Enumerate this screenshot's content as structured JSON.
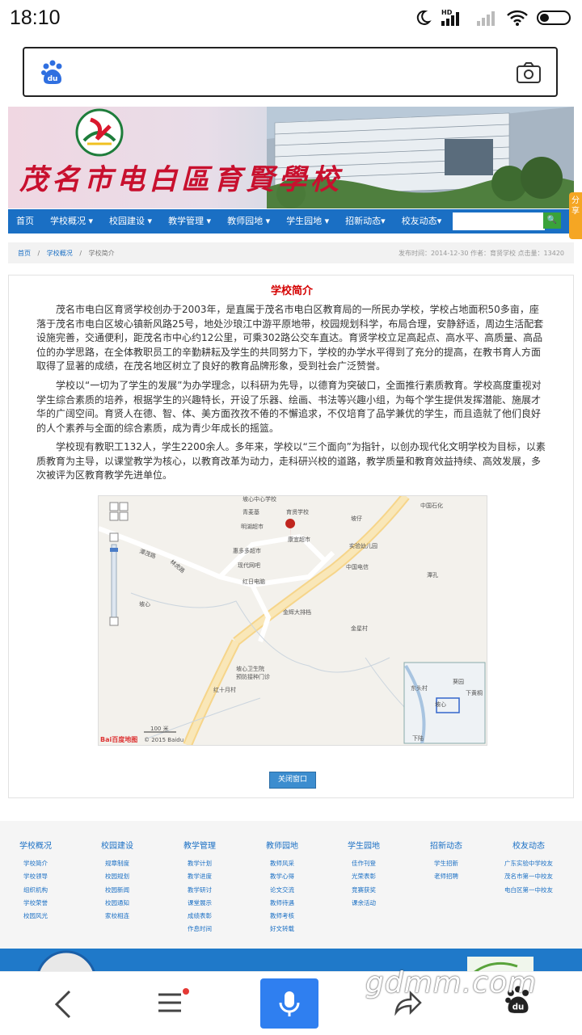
{
  "status": {
    "time": "18:10",
    "hd": "HD"
  },
  "icons": [
    "moon-icon",
    "signal-icon",
    "wifi-icon",
    "battery-icon",
    "baidu-paw-icon",
    "camera-icon",
    "back-icon",
    "menu-icon",
    "mic-icon",
    "share-icon",
    "baidu-home-icon"
  ],
  "banner": {
    "title": "茂名市电白區育賢學校"
  },
  "nav": {
    "items": [
      "首页",
      "学校概况",
      "校园建设",
      "教学管理",
      "教师园地",
      "学生园地",
      "招新动态",
      "校友动态"
    ],
    "search_button": "🔍"
  },
  "share_tab": "分享",
  "breadcrumb": {
    "home": "首页",
    "sep": "/",
    "section": "学校概况",
    "current": "学校简介"
  },
  "meta": "发布时间：2014-12-30 作者：育贤学校 点击量：13420",
  "article": {
    "title": "学校简介",
    "paragraphs": [
      "茂名市电白区育贤学校创办于2003年，是直属于茂名市电白区教育局的一所民办学校，学校占地面积50多亩，座落于茂名市电白区坡心镇新风路25号，地处沙琅江中游平原地带，校园规划科学，布局合理，安静舒适，周边生活配套设施完善，交通便利，距茂名市中心约12公里，可乘302路公交车直达。育贤学校立足高起点、高水平、高质量、高品位的办学思路，在全体教职员工的辛勤耕耘及学生的共同努力下，学校的办学水平得到了充分的提高，在教书育人方面取得了显著的成绩，在茂名地区树立了良好的教育品牌形象，受到社会广泛赞誉。",
      "学校以“一切为了学生的发展”为办学理念，以科研为先导，以德育为突破口，全面推行素质教育。学校高度重视对学生综合素质的培养，根据学生的兴趣特长，开设了乐器、绘画、书法等兴趣小组，为每个学生提供发挥潜能、施展才华的广阔空间。育贤人在德、智、体、美方面孜孜不倦的不懈追求，不仅培育了品学兼优的学生，而且造就了他们良好的人个素养与全面的综合素质，成为青少年成长的摇篮。",
      "学校现有教职工132人，学生2200余人。多年来，学校以“三个面向”为指针，以创办现代化文明学校为目标，以素质教育为主导，以课堂教学为核心，以教育改革为动力，走科研兴校的道路，教学质量和教育效益持续、高效发展，多次被评为区教育教学先进单位。"
    ]
  },
  "map": {
    "labels": [
      "坡心中心学校",
      "育贤学校",
      "青麦基",
      "明湖超市",
      "康宜超市",
      "惠多多超市",
      "现代网吧",
      "红日电脑",
      "实验幼儿园",
      "中国电信",
      "中国石化",
      "坡仔",
      "潭孔",
      "坡心",
      "金星村",
      "金辉大排档",
      "坡心卫生院",
      "预防接种门诊",
      "红十月村",
      "潭茂路",
      "林虎路",
      "东头村",
      "坡心",
      "下黄桐",
      "葵园",
      "下陆"
    ],
    "scale": "100 米",
    "copyright": "© 2015 Baidu",
    "brand": "Bai百度地图"
  },
  "close_button": "关闭窗口",
  "footer": {
    "columns": [
      {
        "head": "学校概况",
        "links": [
          "学校简介",
          "学校领导",
          "组织机构",
          "学校荣誉",
          "校园风光"
        ]
      },
      {
        "head": "校园建设",
        "links": [
          "规章制度",
          "校园规划",
          "校园新闻",
          "校园通知",
          "家校相连"
        ]
      },
      {
        "head": "教学管理",
        "links": [
          "教学计划",
          "教学进度",
          "教学研讨",
          "课堂展示",
          "成绩表彰",
          "作息时间"
        ]
      },
      {
        "head": "教师园地",
        "links": [
          "教师风采",
          "教学心得",
          "论文交流",
          "教师待遇",
          "教师考核",
          "好文转载"
        ]
      },
      {
        "head": "学生园地",
        "links": [
          "佳作刊登",
          "光荣表彰",
          "竞赛获奖",
          "课余活动"
        ]
      },
      {
        "head": "招新动态",
        "links": [
          "学生招新",
          "老师招聘"
        ]
      },
      {
        "head": "校友动态",
        "links": [
          "广东实验中学校友",
          "茂名市第一中校友",
          "电白区第一中校友"
        ]
      }
    ]
  },
  "watermark": "gdmm.com",
  "colors": {
    "nav": "#1a6fc4",
    "title_red": "#d40000",
    "mic_button": "#2f7ff0",
    "share_tab": "#f5a623"
  }
}
